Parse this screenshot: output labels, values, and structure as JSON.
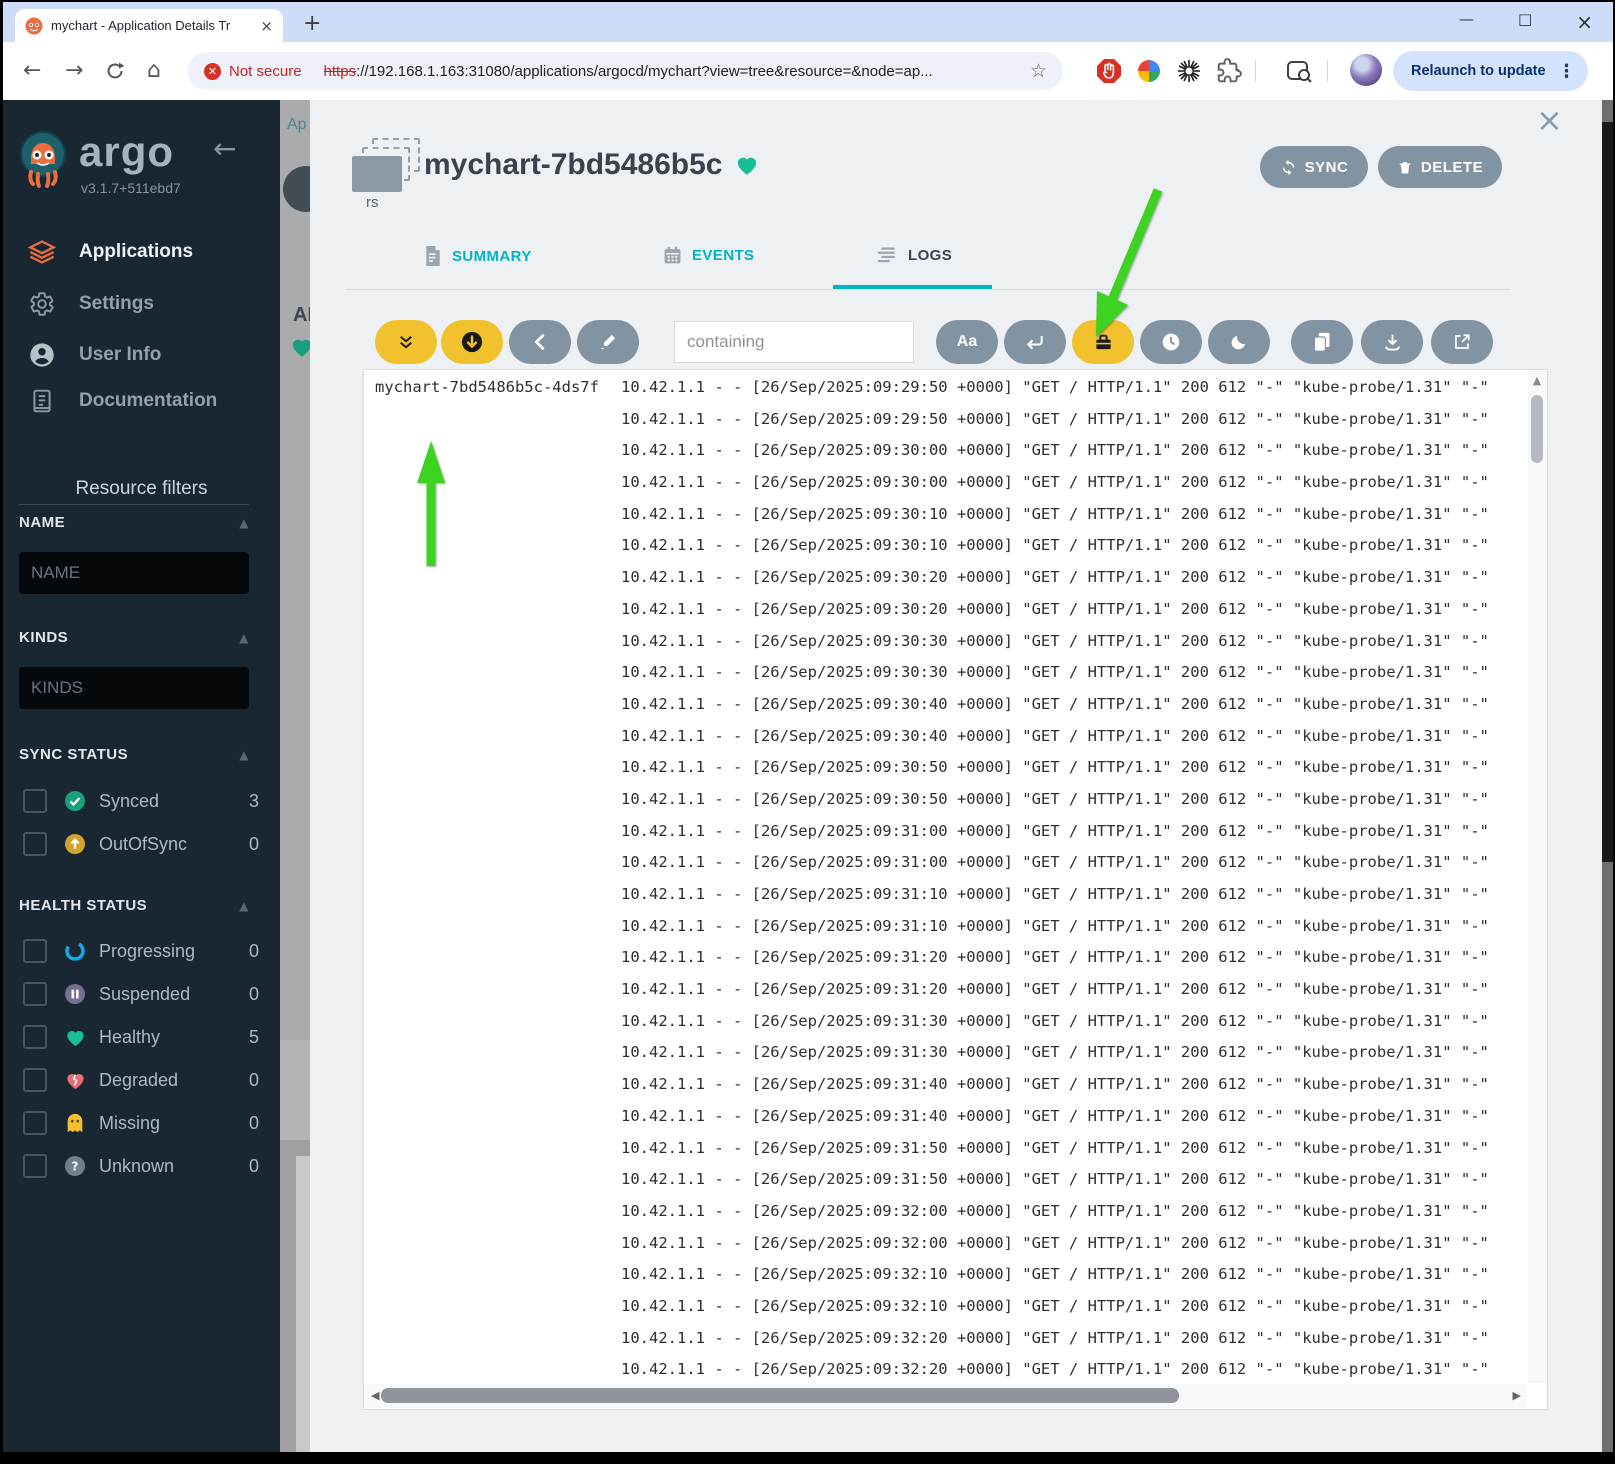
{
  "browser": {
    "tab": {
      "title": "mychart - Application Details Tr",
      "close": "×",
      "new_tab": "+"
    },
    "window_controls": {
      "minimize": "—",
      "maximize": "□",
      "close": "×"
    },
    "security_chip": "Not secure",
    "url": {
      "scheme": "https",
      "rest": "://192.168.1.163:31080/applications/argocd/mychart?view=tree&resource=&node=ap..."
    },
    "relaunch_button": "Relaunch to update",
    "nav_icons": [
      "back",
      "forward",
      "reload",
      "home"
    ],
    "extension_icons": [
      "adblock",
      "photos",
      "starburst",
      "extensions-puzzle",
      "tab-search"
    ]
  },
  "sidebar": {
    "logo_text": "argo",
    "version": "v3.1.7+511ebd7",
    "items": [
      {
        "label": "Applications",
        "icon": "layers"
      },
      {
        "label": "Settings",
        "icon": "gear"
      },
      {
        "label": "User Info",
        "icon": "user"
      },
      {
        "label": "Documentation",
        "icon": "book"
      }
    ],
    "filters": {
      "title": "Resource filters",
      "name": {
        "label": "NAME",
        "placeholder": "NAME"
      },
      "kinds": {
        "label": "KINDS",
        "placeholder": "KINDS"
      },
      "sync": {
        "label": "SYNC STATUS",
        "items": [
          {
            "label": "Synced",
            "count": "3",
            "icon": "check-circle"
          },
          {
            "label": "OutOfSync",
            "count": "0",
            "icon": "arrow-up-circle"
          }
        ]
      },
      "health": {
        "label": "HEALTH STATUS",
        "items": [
          {
            "label": "Progressing",
            "count": "0",
            "icon": "progress-ring"
          },
          {
            "label": "Suspended",
            "count": "0",
            "icon": "pause-circle"
          },
          {
            "label": "Healthy",
            "count": "5",
            "icon": "heart"
          },
          {
            "label": "Degraded",
            "count": "0",
            "icon": "broken-heart"
          },
          {
            "label": "Missing",
            "count": "0",
            "icon": "ghost"
          },
          {
            "label": "Unknown",
            "count": "0",
            "icon": "question-circle"
          }
        ]
      }
    }
  },
  "background_page": {
    "breadcrumb_fragment": "Ap",
    "label_fragment": "AI"
  },
  "panel": {
    "close": "×",
    "resource": {
      "kind_badge": "rs",
      "title": "mychart-7bd5486b5c",
      "health_icon": "heart"
    },
    "actions": {
      "sync": "SYNC",
      "delete": "DELETE"
    },
    "tabs": [
      {
        "label": "SUMMARY"
      },
      {
        "label": "EVENTS"
      },
      {
        "label": "LOGS"
      }
    ],
    "active_tab": "LOGS",
    "log_toolbar": {
      "search_placeholder": "containing",
      "case_button": "Aa",
      "buttons": [
        "scroll-to-bottom",
        "follow-logs",
        "previous-page",
        "highlight",
        "match-case",
        "wrap-lines",
        "pod-names",
        "timestamps",
        "dark-mode",
        "copy-logs",
        "download-logs",
        "fullscreen"
      ]
    },
    "logs": {
      "pod_name": "mychart-7bd5486b5c-4ds7f",
      "line_prefix": "10.42.1.1 - - [26/Sep/2025:",
      "line_suffix": " +0000] \"GET / HTTP/1.1\" 200 612 \"-\" \"kube-probe/1.31\" \"-\"",
      "times": [
        "09:29:50",
        "09:29:50",
        "09:30:00",
        "09:30:00",
        "09:30:10",
        "09:30:10",
        "09:30:20",
        "09:30:20",
        "09:30:30",
        "09:30:30",
        "09:30:40",
        "09:30:40",
        "09:30:50",
        "09:30:50",
        "09:31:00",
        "09:31:00",
        "09:31:10",
        "09:31:10",
        "09:31:20",
        "09:31:20",
        "09:31:30",
        "09:31:30",
        "09:31:40",
        "09:31:40",
        "09:31:50",
        "09:31:50",
        "09:32:00",
        "09:32:00",
        "09:32:10",
        "09:32:10",
        "09:32:20",
        "09:32:20"
      ]
    }
  },
  "colors": {
    "accent_yellow": "#f2c12e",
    "accent_cyan": "#00b3c6",
    "success_green": "#18be94",
    "gray_button": "#8293a2",
    "sidebar_bg": "#182731",
    "annotation_green": "#3ed321",
    "degraded_red": "#e96d76",
    "progressing_blue": "#0dadea",
    "suspended_purple": "#766f94",
    "missing_yellow": "#f4c030",
    "unknown_gray": "#6d7f8b",
    "not_secure_red": "#c5221f",
    "apps_icon_orange": "#e96d3f"
  }
}
